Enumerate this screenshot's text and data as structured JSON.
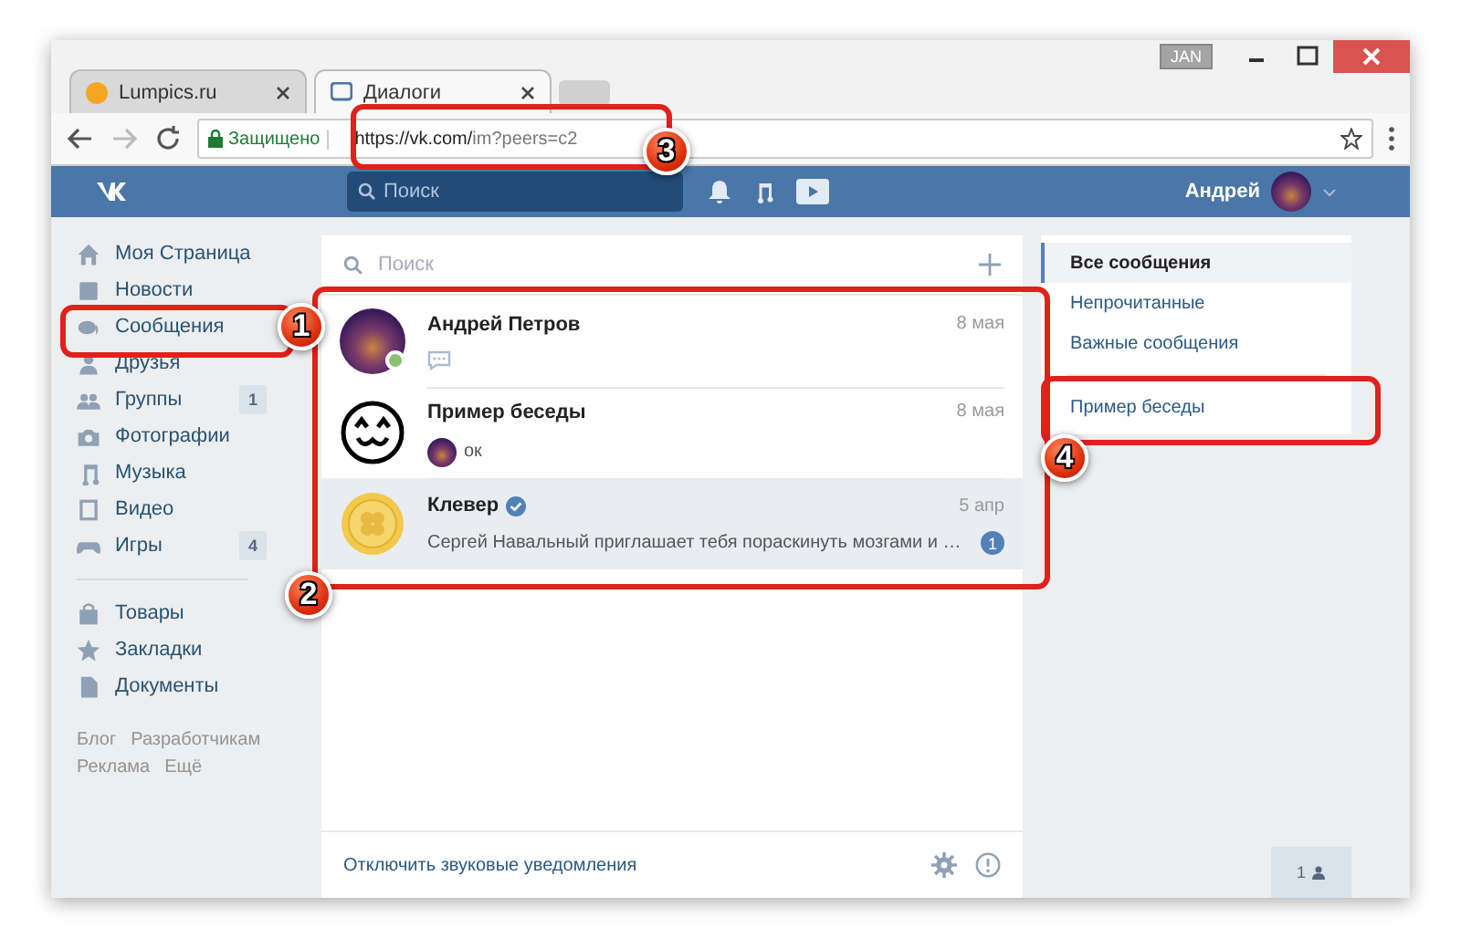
{
  "browser": {
    "tabs": [
      {
        "title": "Lumpics.ru",
        "selected": false
      },
      {
        "title": "Диалоги",
        "selected": true
      }
    ],
    "profile_badge": "JAN",
    "address": {
      "secure_label": "Защищено",
      "url_host": "https://vk.com/",
      "url_path": "im?peers=c2"
    }
  },
  "header": {
    "search": {
      "placeholder": "Поиск"
    },
    "user_name": "Андрей"
  },
  "sidebar": {
    "groups": [
      [
        {
          "label": "Моя Страница"
        },
        {
          "label": "Новости"
        },
        {
          "label": "Сообщения"
        },
        {
          "label": "Друзья"
        },
        {
          "label": "Группы",
          "badge": "1"
        },
        {
          "label": "Фотографии"
        },
        {
          "label": "Музыка"
        },
        {
          "label": "Видео"
        },
        {
          "label": "Игры",
          "badge": "4"
        }
      ],
      [
        {
          "label": "Товары"
        },
        {
          "label": "Закладки"
        },
        {
          "label": "Документы"
        }
      ]
    ],
    "footer_links": [
      "Блог",
      "Разработчикам",
      "Реклама",
      "Ещё"
    ]
  },
  "dialogs": {
    "search": {
      "placeholder": "Поиск"
    },
    "items": [
      {
        "name": "Андрей Петров",
        "date": "8 мая",
        "online": true,
        "verified": false,
        "selected": false,
        "preview": {
          "kind": "typing"
        }
      },
      {
        "name": "Пример беседы",
        "date": "8 мая",
        "online": false,
        "verified": false,
        "selected": false,
        "preview": {
          "kind": "author",
          "text": "ок"
        }
      },
      {
        "name": "Клевер",
        "date": "5 апр",
        "online": false,
        "verified": true,
        "selected": true,
        "preview": {
          "kind": "text",
          "text": "Сергей Навальный приглашает тебя пораскинуть мозгами и …"
        },
        "unread": "1"
      }
    ],
    "footer": {
      "mute_link": "Отключить звуковые уведомления"
    }
  },
  "filters": {
    "items": [
      {
        "label": "Все сообщения",
        "selected": true
      },
      {
        "label": "Непрочитанные",
        "selected": false
      },
      {
        "label": "Важные сообщения",
        "selected": false
      }
    ],
    "chats": [
      {
        "label": "Пример беседы",
        "selected": false
      }
    ]
  },
  "online_counter": "1",
  "callouts": [
    "1",
    "2",
    "3",
    "4"
  ]
}
